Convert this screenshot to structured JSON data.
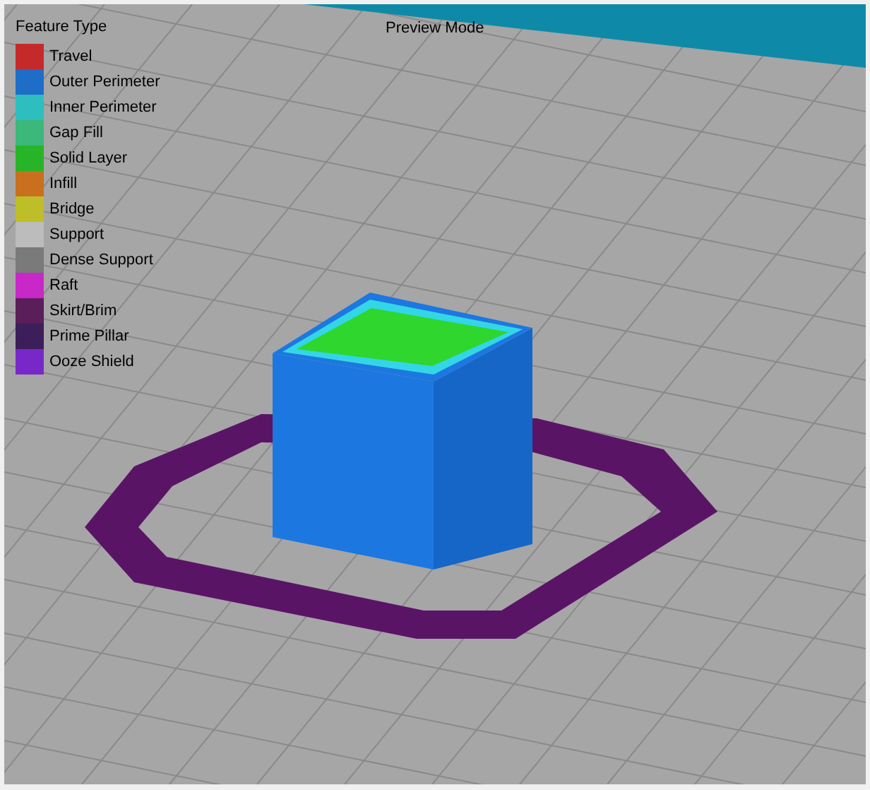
{
  "legend": {
    "title": "Feature Type",
    "items": [
      {
        "label": "Travel",
        "color": "#c42a2a"
      },
      {
        "label": "Outer Perimeter",
        "color": "#1e6ec8"
      },
      {
        "label": "Inner Perimeter",
        "color": "#2ebebe"
      },
      {
        "label": "Gap Fill",
        "color": "#3cb87a"
      },
      {
        "label": "Solid Layer",
        "color": "#28b428"
      },
      {
        "label": "Infill",
        "color": "#c8701e"
      },
      {
        "label": "Bridge",
        "color": "#bebe28"
      },
      {
        "label": "Support",
        "color": "#bcbcbc"
      },
      {
        "label": "Dense Support",
        "color": "#7a7a7a"
      },
      {
        "label": "Raft",
        "color": "#c828c8"
      },
      {
        "label": "Skirt/Brim",
        "color": "#5a1e5a"
      },
      {
        "label": "Prime Pillar",
        "color": "#3c1e5a"
      },
      {
        "label": "Ooze Shield",
        "color": "#7828c8"
      }
    ]
  },
  "mode_label": "Preview Mode"
}
